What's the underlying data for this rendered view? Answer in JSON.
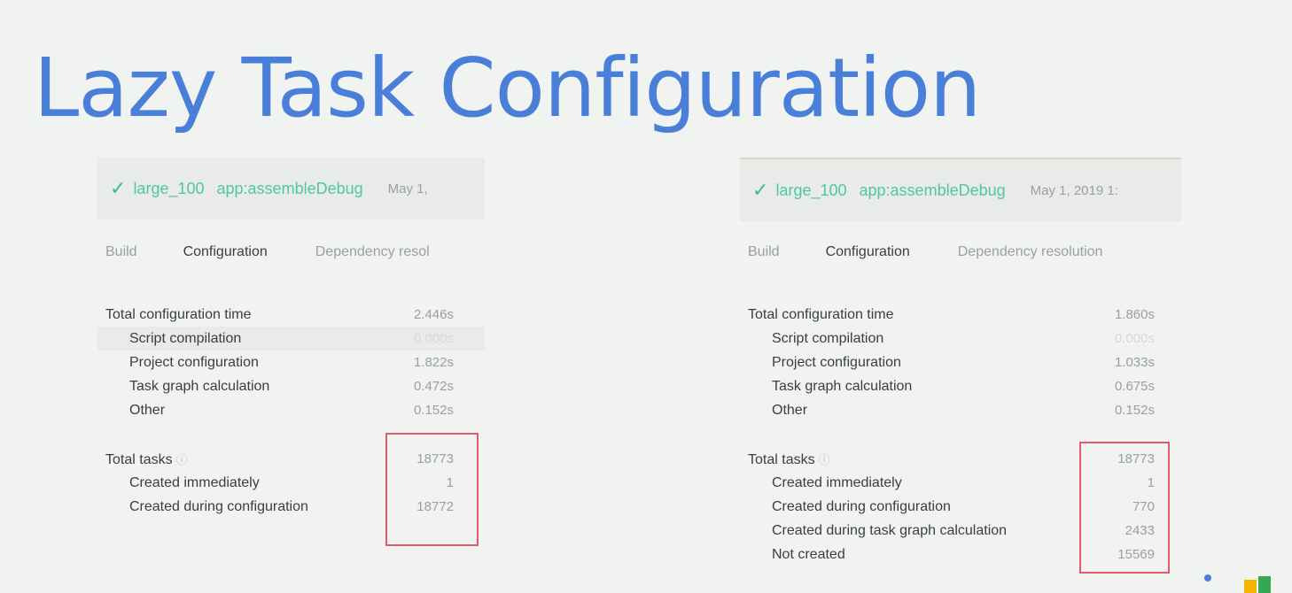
{
  "title": "Lazy Task Configuration",
  "colors": {
    "title": "#4a7fd9",
    "success": "#4fc99c",
    "highlight": "#e35a6a"
  },
  "left_panel": {
    "header": {
      "project": "large_100",
      "task": "app:assembleDebug",
      "date": "May 1,"
    },
    "tabs": [
      "Build",
      "Configuration",
      "Dependency resol"
    ],
    "config_rows": [
      {
        "label": "Total configuration time",
        "value": "2.446s"
      },
      {
        "label": "Script compilation",
        "value": "0.000s"
      },
      {
        "label": "Project configuration",
        "value": "1.822s"
      },
      {
        "label": "Task graph calculation",
        "value": "0.472s"
      },
      {
        "label": "Other",
        "value": "0.152s"
      }
    ],
    "task_rows": [
      {
        "label": "Total tasks",
        "value": "18773"
      },
      {
        "label": "Created immediately",
        "value": "1"
      },
      {
        "label": "Created during configuration",
        "value": "18772"
      }
    ]
  },
  "right_panel": {
    "header": {
      "project": "large_100",
      "task": "app:assembleDebug",
      "date": "May 1, 2019 1:"
    },
    "tabs": [
      "Build",
      "Configuration",
      "Dependency resolution"
    ],
    "config_rows": [
      {
        "label": "Total configuration time",
        "value": "1.860s"
      },
      {
        "label": "Script compilation",
        "value": "0.000s"
      },
      {
        "label": "Project configuration",
        "value": "1.033s"
      },
      {
        "label": "Task graph calculation",
        "value": "0.675s"
      },
      {
        "label": "Other",
        "value": "0.152s"
      }
    ],
    "task_rows": [
      {
        "label": "Total tasks",
        "value": "18773"
      },
      {
        "label": "Created immediately",
        "value": "1"
      },
      {
        "label": "Created during configuration",
        "value": "770"
      },
      {
        "label": "Created during task graph calculation",
        "value": "2433"
      },
      {
        "label": "Not created",
        "value": "15569"
      }
    ]
  }
}
